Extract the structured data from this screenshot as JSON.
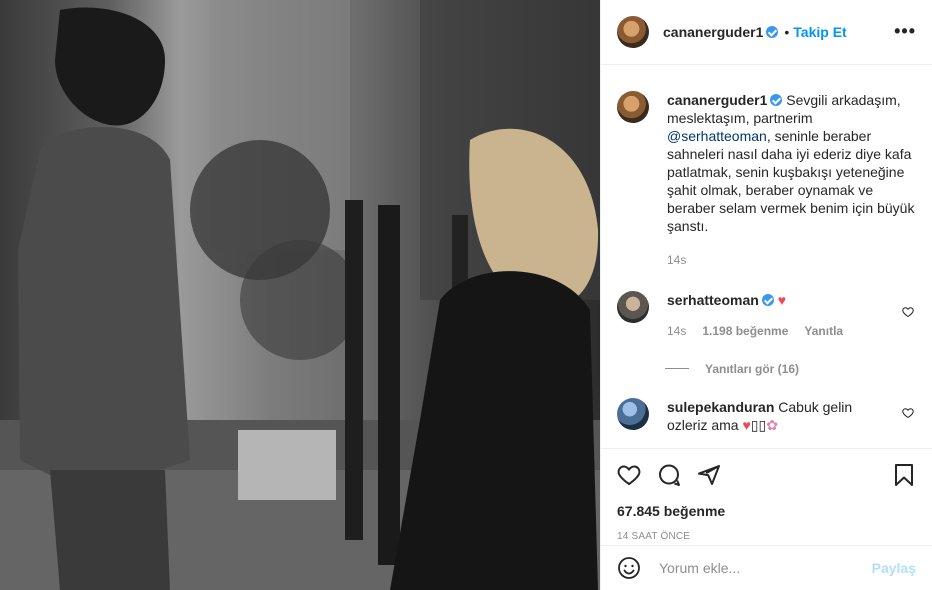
{
  "post": {
    "author": "cananerguder1",
    "follow_label": "Takip Et",
    "more_label": "•••",
    "caption": {
      "author": "cananerguder1",
      "text_before": " Sevgili arkadaşım, meslektaşım, partnerim ",
      "mention": "@serhatteoman",
      "text_after": ", seninle beraber sahneleri nasıl daha iyi ederiz diye kafa patlatmak, senin kuşbakışı yeteneğine şahit olmak, beraber oynamak ve beraber selam vermek benim için büyük şanstı.",
      "time": "14s"
    },
    "comments": [
      {
        "author": "serhatteoman",
        "text": "♥",
        "time": "14s",
        "likes": "1.198 beğenme",
        "reply": "Yanıtla",
        "view_replies": "Yanıtları gör (16)"
      },
      {
        "author": "sulepekanduran",
        "text": " Cabuk gelin ozleriz ama ",
        "emoji_heart": "♥",
        "emoji_boxes": "▯▯",
        "emoji_flower": "✿"
      }
    ],
    "likes_count": "67.845 beğenme",
    "timestamp": "14 SAAT ÖNCE",
    "comment_placeholder": "Yorum ekle...",
    "post_button": "Paylaş"
  },
  "colors": {
    "link_blue": "#0095f6",
    "verified_blue": "#3897f0",
    "heart_red": "#ed4956",
    "post_disabled": "#b2dffc"
  },
  "icons": [
    "verified-badge-icon",
    "heart-icon",
    "comment-icon",
    "share-icon",
    "bookmark-icon",
    "emoji-icon"
  ]
}
